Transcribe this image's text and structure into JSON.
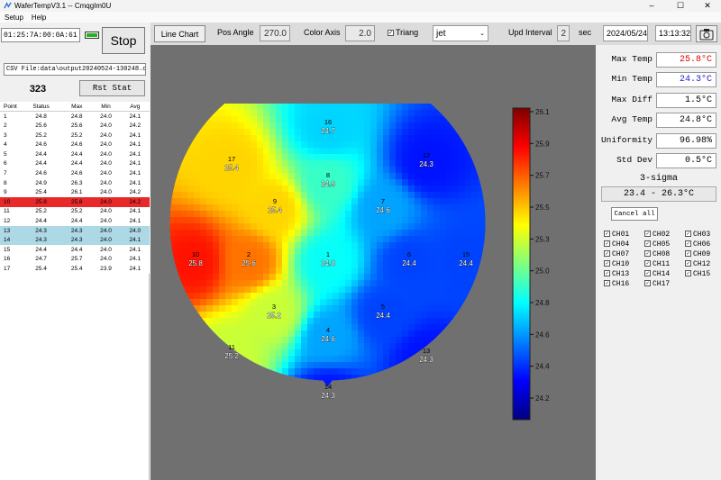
{
  "window": {
    "title": "WaferTempV3.1 -- CmqgIm0U",
    "controls": [
      "–",
      "☐",
      "✕"
    ]
  },
  "menu": [
    "Setup",
    "Help"
  ],
  "left": {
    "device_id": "01:25:7A:00:0A:61",
    "stop_label": "Stop",
    "csv_path": "CSV File:data\\output20240524-130248.csv",
    "count": "323",
    "rst_label": "Rst Stat",
    "table": {
      "headers": [
        "Point",
        "Status",
        "Max",
        "Min",
        "Avg"
      ],
      "rows": [
        [
          "1",
          "24.8",
          "24.8",
          "24.0",
          "24.1"
        ],
        [
          "2",
          "25.6",
          "25.6",
          "24.0",
          "24.2"
        ],
        [
          "3",
          "25.2",
          "25.2",
          "24.0",
          "24.1"
        ],
        [
          "4",
          "24.6",
          "24.6",
          "24.0",
          "24.1"
        ],
        [
          "5",
          "24.4",
          "24.4",
          "24.0",
          "24.1"
        ],
        [
          "6",
          "24.4",
          "24.4",
          "24.0",
          "24.1"
        ],
        [
          "7",
          "24.6",
          "24.6",
          "24.0",
          "24.1"
        ],
        [
          "8",
          "24.9",
          "26.3",
          "24.0",
          "24.1"
        ],
        [
          "9",
          "25.4",
          "26.1",
          "24.0",
          "24.2"
        ],
        [
          "10",
          "25.8",
          "25.8",
          "24.0",
          "24.2"
        ],
        [
          "11",
          "25.2",
          "25.2",
          "24.0",
          "24.1"
        ],
        [
          "12",
          "24.4",
          "24.4",
          "24.0",
          "24.1"
        ],
        [
          "13",
          "24.3",
          "24.3",
          "24.0",
          "24.0"
        ],
        [
          "14",
          "24.3",
          "24.3",
          "24.0",
          "24.1"
        ],
        [
          "15",
          "24.4",
          "24.4",
          "24.0",
          "24.1"
        ],
        [
          "16",
          "24.7",
          "25.7",
          "24.0",
          "24.1"
        ],
        [
          "17",
          "25.4",
          "25.4",
          "23.9",
          "24.1"
        ]
      ],
      "row_highlights": {
        "10": "#e8292a",
        "13": "#add8e6",
        "14": "#add8e6"
      }
    }
  },
  "toolbar": {
    "line_chart_label": "Line Chart",
    "pos_angle_label": "Pos Angle",
    "pos_angle_value": "270.0",
    "color_axis_label": "Color Axis",
    "color_axis_value": "2.0",
    "triang_label": "Triang",
    "triang_checked": "✓",
    "colormap_value": "jet",
    "upd_interval_label": "Upd Interval",
    "upd_interval_value": "2",
    "sec_label": "sec",
    "date": "2024/05/24",
    "time": "13:13:32"
  },
  "wafer": {
    "points": [
      {
        "id": "1",
        "temp": "24.8",
        "v": 24.8
      },
      {
        "id": "2",
        "temp": "25.6",
        "v": 25.6
      },
      {
        "id": "3",
        "temp": "25.2",
        "v": 25.2
      },
      {
        "id": "4",
        "temp": "24.6",
        "v": 24.6
      },
      {
        "id": "5",
        "temp": "24.4",
        "v": 24.4
      },
      {
        "id": "6",
        "temp": "24.4",
        "v": 24.4
      },
      {
        "id": "7",
        "temp": "24.6",
        "v": 24.6
      },
      {
        "id": "8",
        "temp": "24.9",
        "v": 24.9
      },
      {
        "id": "9",
        "temp": "25.4",
        "v": 25.4
      },
      {
        "id": "10",
        "temp": "25.8",
        "v": 25.8
      },
      {
        "id": "11",
        "temp": "25.2",
        "v": 25.2
      },
      {
        "id": "12",
        "temp": "24.3",
        "v": 24.3
      },
      {
        "id": "13",
        "temp": "24.3",
        "v": 24.3
      },
      {
        "id": "14",
        "temp": "24.3",
        "v": 24.3
      },
      {
        "id": "15",
        "temp": "24.4",
        "v": 24.4
      },
      {
        "id": "16",
        "temp": "24.7",
        "v": 24.7
      },
      {
        "id": "17",
        "temp": "25.4",
        "v": 25.4
      }
    ],
    "colorbar_ticks": [
      "26.1",
      "25.9",
      "25.7",
      "25.5",
      "25.3",
      "25.0",
      "24.8",
      "24.6",
      "24.4",
      "24.2"
    ],
    "colorbar_min": 24.0,
    "colorbar_max": 26.1
  },
  "right": {
    "stats": [
      {
        "label": "Max Temp",
        "value": "25.8°C",
        "color": "#e00000"
      },
      {
        "label": "Min Temp",
        "value": "24.3°C",
        "color": "#1a1ad0"
      },
      {
        "label": "Max Diff",
        "value": "1.5°C",
        "color": "#000000"
      },
      {
        "label": "Avg Temp",
        "value": "24.8°C",
        "color": "#000000"
      },
      {
        "label": "Uniformity",
        "value": "96.98%",
        "color": "#000000"
      },
      {
        "label": "Std Dev",
        "value": "0.5°C",
        "color": "#000000"
      }
    ],
    "sigma_label": "3-sigma",
    "sigma_value": "23.4 - 26.3°C",
    "cancel_label": "Cancel all",
    "channels": [
      "CH01",
      "CH02",
      "CH03",
      "CH04",
      "CH05",
      "CH06",
      "CH07",
      "CH08",
      "CH09",
      "CH10",
      "CH11",
      "CH12",
      "CH13",
      "CH14",
      "CH15",
      "CH16",
      "CH17"
    ]
  }
}
